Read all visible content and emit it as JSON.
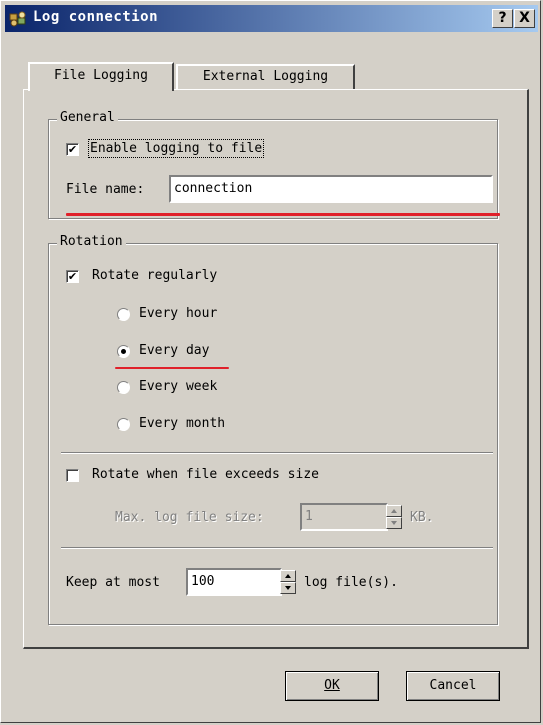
{
  "window": {
    "title": "Log connection",
    "help_label": "?",
    "close_label": "X"
  },
  "tabs": [
    {
      "label": "File Logging",
      "selected": true
    },
    {
      "label": "External Logging",
      "selected": false
    }
  ],
  "general": {
    "legend": "General",
    "enable_logging": {
      "label": "Enable logging to file",
      "checked": true
    },
    "file_name_label": "File name:",
    "file_name_value": "connection"
  },
  "rotation": {
    "legend": "Rotation",
    "rotate_regularly": {
      "label": "Rotate regularly",
      "checked": true
    },
    "options": [
      {
        "label": "Every hour",
        "selected": false
      },
      {
        "label": "Every day",
        "selected": true
      },
      {
        "label": "Every week",
        "selected": false
      },
      {
        "label": "Every month",
        "selected": false
      }
    ],
    "rotate_size": {
      "label": "Rotate when file exceeds size",
      "checked": false
    },
    "max_size_label": "Max. log file size:",
    "max_size_value": "1",
    "max_size_unit": "KB.",
    "keep_label": "Keep at most",
    "keep_value": "100",
    "keep_unit": "log file(s)."
  },
  "buttons": {
    "ok": "OK",
    "cancel": "Cancel"
  },
  "colors": {
    "title_bar_start": "#0a246a",
    "title_bar_end": "#a6caf0",
    "annotation_red": "#e0202a",
    "face": "#d4d0c8"
  }
}
